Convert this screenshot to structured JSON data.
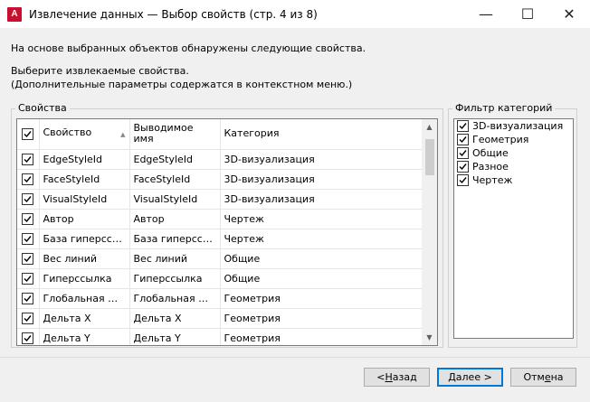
{
  "window": {
    "app_icon_letter": "A",
    "title": "Извлечение данных — Выбор свойств (стр. 4 из 8)",
    "minimize": "—",
    "maximize": "☐",
    "close": "✕"
  },
  "info": {
    "line1": "На основе выбранных объектов обнаружены следующие свойства.",
    "line2": "Выберите извлекаемые свойства.",
    "line3": "(Дополнительные параметры содержатся в контекстном меню.)"
  },
  "properties": {
    "group_label": "Свойства",
    "columns": [
      "Свойство",
      "Выводимое имя",
      "Категория"
    ],
    "column_header_2_line1": "Выводимое",
    "column_header_2_line2": "имя",
    "rows": [
      {
        "checked": true,
        "property": "EdgeStyleId",
        "display": "EdgeStyleId",
        "category": "3D-визуализация"
      },
      {
        "checked": true,
        "property": "FaceStyleId",
        "display": "FaceStyleId",
        "category": "3D-визуализация"
      },
      {
        "checked": true,
        "property": "VisualStyleId",
        "display": "VisualStyleId",
        "category": "3D-визуализация"
      },
      {
        "checked": true,
        "property": "Автор",
        "display": "Автор",
        "category": "Чертеж"
      },
      {
        "checked": true,
        "property": "База гиперссыл...",
        "display": "База гиперссыл...",
        "category": "Чертеж"
      },
      {
        "checked": true,
        "property": "Вес линий",
        "display": "Вес линий",
        "category": "Общие"
      },
      {
        "checked": true,
        "property": "Гиперссылка",
        "display": "Гиперссылка",
        "category": "Общие"
      },
      {
        "checked": true,
        "property": "Глобальная шир...",
        "display": "Глобальная шир...",
        "category": "Геометрия"
      },
      {
        "checked": true,
        "property": "Дельта X",
        "display": "Дельта X",
        "category": "Геометрия"
      },
      {
        "checked": true,
        "property": "Дельта Y",
        "display": "Дельта Y",
        "category": "Геометрия"
      }
    ]
  },
  "filter": {
    "group_label": "Фильтр категорий",
    "items": [
      {
        "checked": true,
        "label": "3D-визуализация"
      },
      {
        "checked": true,
        "label": "Геометрия"
      },
      {
        "checked": true,
        "label": "Общие"
      },
      {
        "checked": true,
        "label": "Разное"
      },
      {
        "checked": true,
        "label": "Чертеж"
      }
    ]
  },
  "buttons": {
    "back_prefix": "< ",
    "back_accel": "Н",
    "back_rest": "азад",
    "next_accel": "Д",
    "next_rest": "алее >",
    "cancel_prefix": "Отм",
    "cancel_accel": "е",
    "cancel_rest": "на"
  },
  "colors": {
    "accent": "#0078d7",
    "app_icon": "#c8102e"
  }
}
